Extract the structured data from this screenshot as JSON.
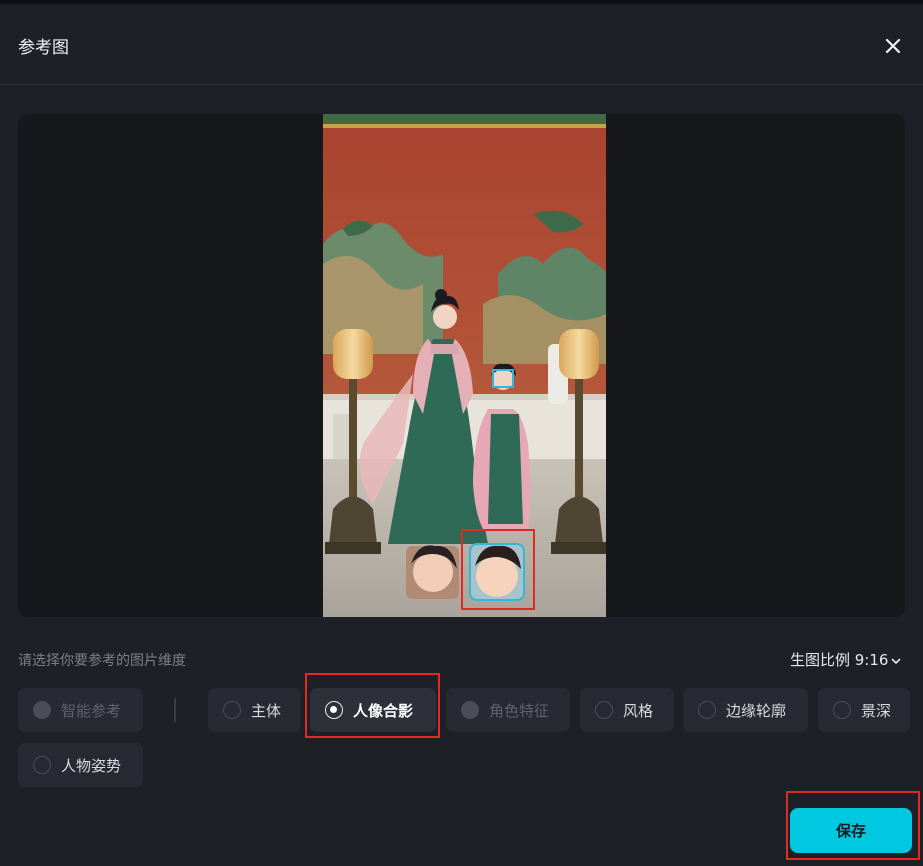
{
  "dialog": {
    "title": "参考图",
    "close_icon": "close-icon"
  },
  "preview": {
    "image_subject": "reference-photo",
    "face_icons": [
      "face-thumbnail-woman",
      "face-thumbnail-child"
    ]
  },
  "dimension": {
    "hint": "请选择你要参考的图片维度",
    "ratio_label": "生图比例 9:16",
    "ratio_icon": "chevron-down-icon"
  },
  "options": [
    {
      "label": "智能参考",
      "state": "disabled"
    },
    {
      "label": "主体",
      "state": "unselected"
    },
    {
      "label": "人像合影",
      "state": "selected"
    },
    {
      "label": "角色特征",
      "state": "disabled"
    },
    {
      "label": "风格",
      "state": "unselected"
    },
    {
      "label": "边缘轮廓",
      "state": "unselected"
    },
    {
      "label": "景深",
      "state": "unselected"
    },
    {
      "label": "人物姿势",
      "state": "unselected"
    }
  ],
  "footer": {
    "save_label": "保存"
  },
  "colors": {
    "accent": "#00c8e1",
    "highlight_box": "#e02a22",
    "face_box": "#2fb8d8"
  }
}
